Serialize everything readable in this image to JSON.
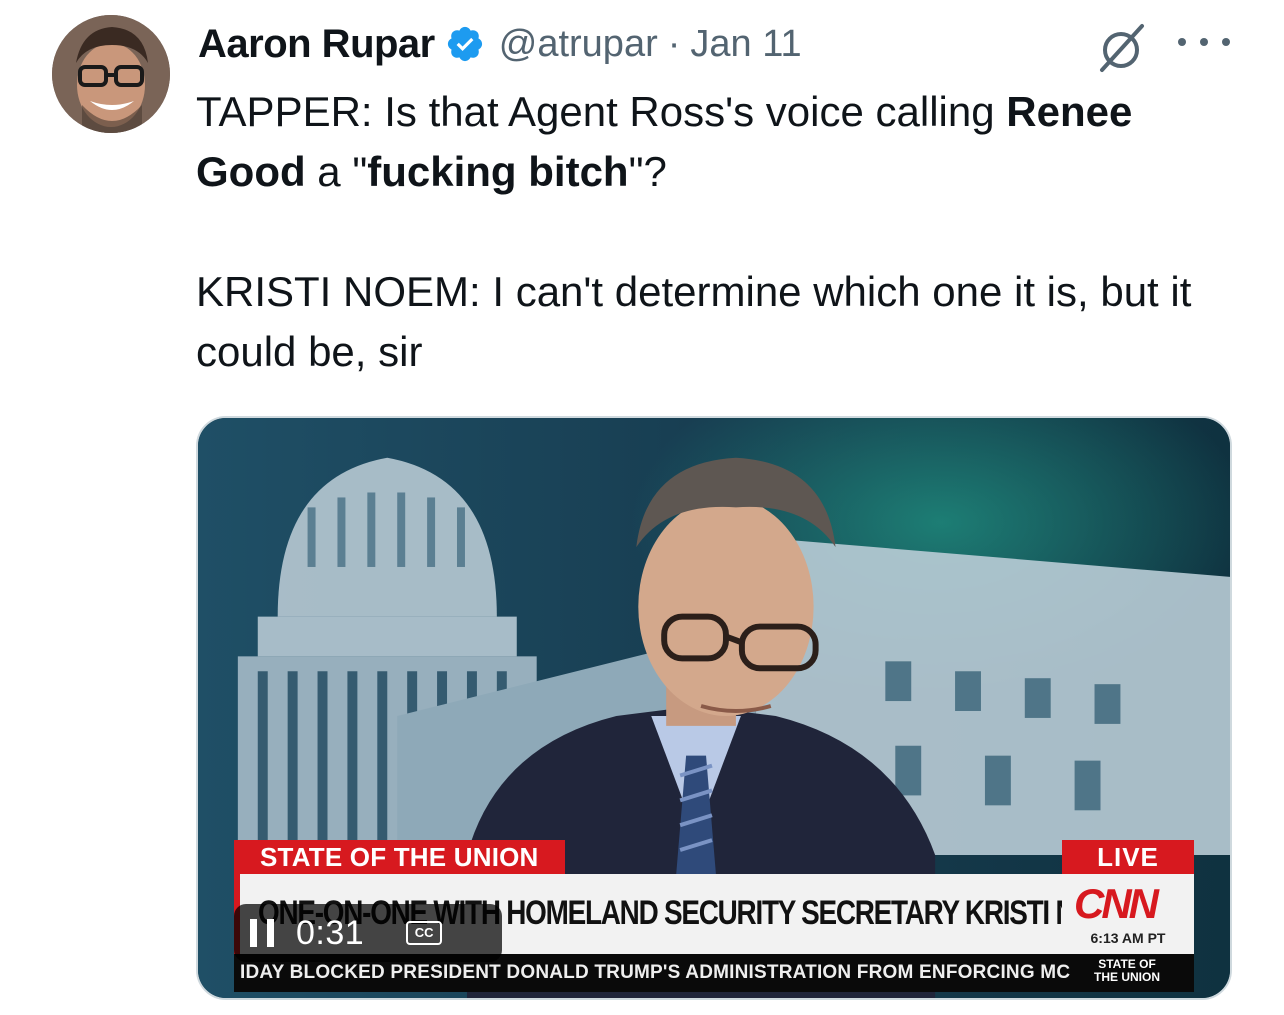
{
  "author": {
    "name": "Aaron Rupar",
    "handle": "@atrupar",
    "separator": "·",
    "date": "Jan 11"
  },
  "colors": {
    "verified": "#1d9bf0",
    "secondary_text": "#536471",
    "cnn_red": "#d7191f"
  },
  "icons": {
    "verified": "verified-badge-icon",
    "grok": "grok-icon",
    "more": "more-options-icon",
    "pause": "pause-icon",
    "cc": "closed-captions-icon"
  },
  "tweet": {
    "line1_prefix": "TAPPER: Is that Agent Ross's voice calling ",
    "bold_name": "Renee Good",
    "line1_mid": " a \"",
    "bold_quote": "fucking bitch",
    "line1_suffix": "\"?",
    "line2": "KRISTI NOEM: I can't determine which one it is, but it could be, sir"
  },
  "video": {
    "show_label": "STATE OF THE UNION",
    "live_label": "LIVE",
    "headline": "ONE-ON-ONE WITH HOMELAND SECURITY SECRETARY KRISTI NOEM",
    "network_logo": "CNN",
    "timestamp": "6:13 AM PT",
    "ticker": "IDAY BLOCKED PRESIDENT DONALD TRUMP'S ADMINISTRATION FROM ENFORCING MC",
    "show_logo_line1": "STATE OF",
    "show_logo_line2": "THE UNION",
    "elapsed": "0:31",
    "cc_label": "CC"
  }
}
